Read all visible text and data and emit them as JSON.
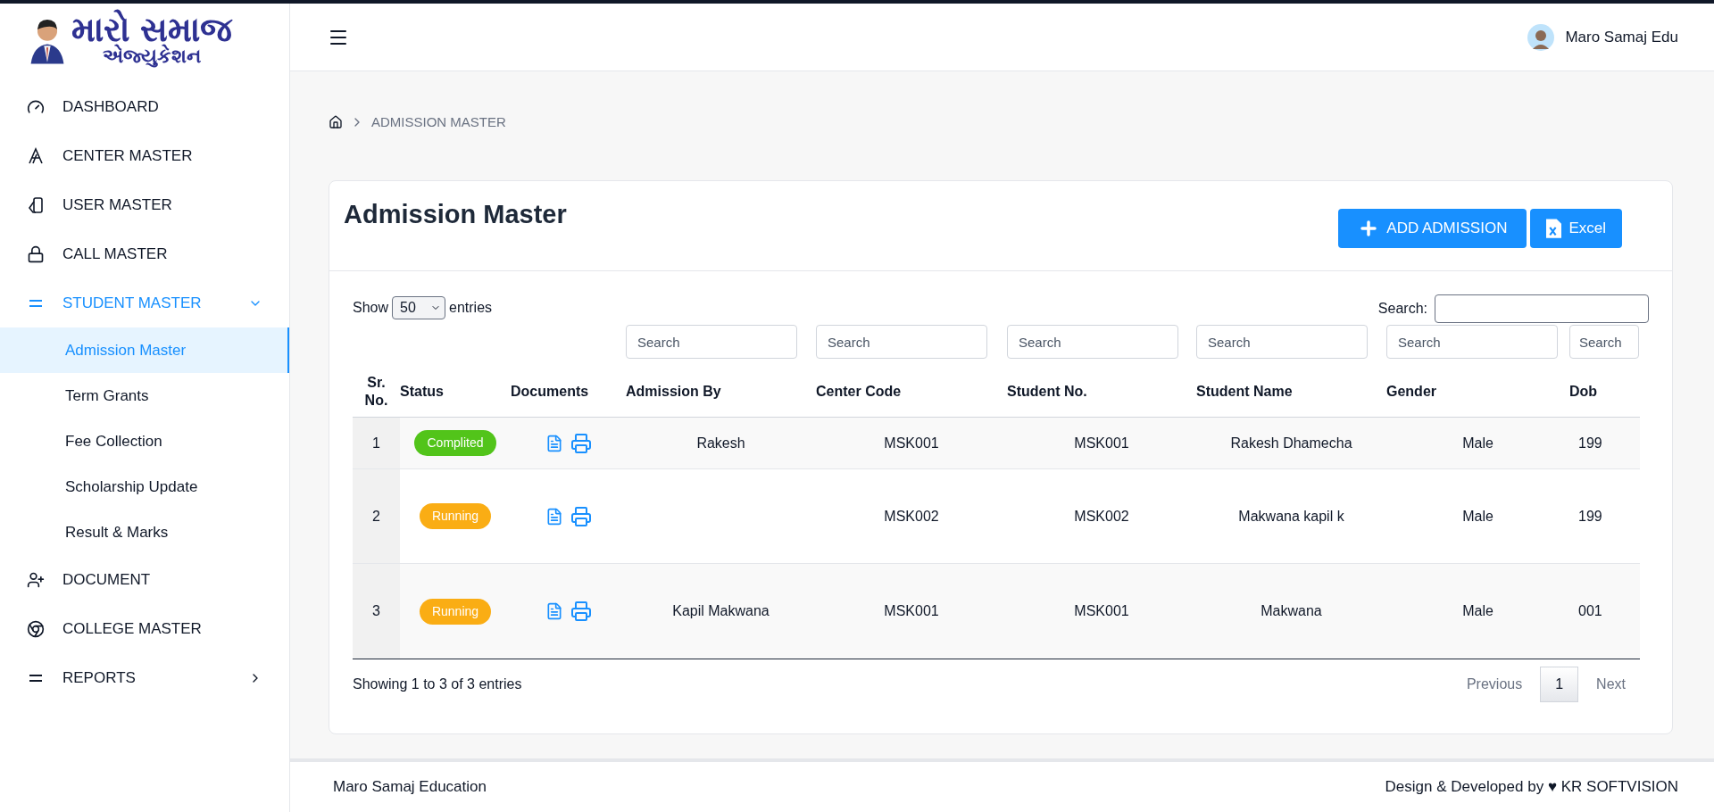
{
  "logo": {
    "title": "મારો સમાજ",
    "subtitle": "એજ્યુકેશન"
  },
  "sidebar": {
    "items": [
      {
        "label": "DASHBOARD",
        "kind": "gauge",
        "selected": false
      },
      {
        "label": "CENTER MASTER",
        "kind": "letter",
        "selected": false
      },
      {
        "label": "USER MASTER",
        "kind": "cards",
        "selected": false
      },
      {
        "label": "CALL MASTER",
        "kind": "lock",
        "selected": false
      },
      {
        "label": "STUDENT MASTER",
        "kind": "lines",
        "selected": true,
        "expanded": true,
        "children": [
          {
            "label": "Admission Master",
            "selected": true
          },
          {
            "label": "Term Grants",
            "selected": false
          },
          {
            "label": "Fee Collection",
            "selected": false
          },
          {
            "label": "Scholarship Update",
            "selected": false
          },
          {
            "label": "Result & Marks",
            "selected": false
          }
        ]
      },
      {
        "label": "DOCUMENT",
        "kind": "person",
        "selected": false
      },
      {
        "label": "COLLEGE MASTER",
        "kind": "circle",
        "selected": false
      },
      {
        "label": "REPORTS",
        "kind": "lines",
        "selected": false,
        "expanded": false
      }
    ]
  },
  "header": {
    "user": "Maro Samaj Edu"
  },
  "breadcrumb": [
    "ADMISSION MASTER"
  ],
  "card": {
    "title": "Admission Master",
    "buttons": [
      {
        "label": "ADD ADMISSION",
        "kind": "add"
      },
      {
        "label": "Excel",
        "kind": "excel"
      }
    ]
  },
  "table": {
    "show_label": "Show",
    "page_size": "50",
    "entries_label": "entries",
    "search_label": "Search:",
    "columns": [
      {
        "header": "Sr. No."
      },
      {
        "header": "Status"
      },
      {
        "header": "Documents"
      },
      {
        "header": "Admission By",
        "placeholder": "Search"
      },
      {
        "header": "Center Code",
        "placeholder": "Search"
      },
      {
        "header": "Student No.",
        "placeholder": "Search"
      },
      {
        "header": "Student Name",
        "placeholder": "Search"
      },
      {
        "header": "Gender",
        "placeholder": "Search"
      },
      {
        "header": "Dob",
        "placeholder": "Search"
      }
    ],
    "rows": [
      {
        "sr": "1",
        "status": {
          "label": "Complited",
          "color": "#52c41a"
        },
        "admission_by": "Rakesh",
        "center_code": "MSK001",
        "student_no": "MSK001",
        "student_name": "Rakesh Dhamecha",
        "gender": "Male",
        "dob": "199"
      },
      {
        "sr": "2",
        "status": {
          "label": "Running",
          "color": "#faad14"
        },
        "center_code": "MSK002",
        "student_no": "MSK002",
        "student_name": "Makwana kapil k",
        "gender": "Male",
        "dob": "199"
      },
      {
        "sr": "3",
        "status": {
          "label": "Running",
          "color": "#faad14"
        },
        "admission_by": "Kapil Makwana",
        "center_code": "MSK001",
        "student_no": "MSK001",
        "student_name": "Makwana",
        "gender": "Male",
        "dob": "001"
      }
    ],
    "info": "Showing 1 to 3 of 3 entries",
    "pagination": [
      {
        "label": "Previous",
        "selected": false
      },
      {
        "label": "1",
        "selected": true
      },
      {
        "label": "Next",
        "selected": false
      }
    ]
  },
  "footer": {
    "left": "Maro Samaj Education",
    "right": "Design & Developed by ♥ KR SOFTVISION"
  }
}
